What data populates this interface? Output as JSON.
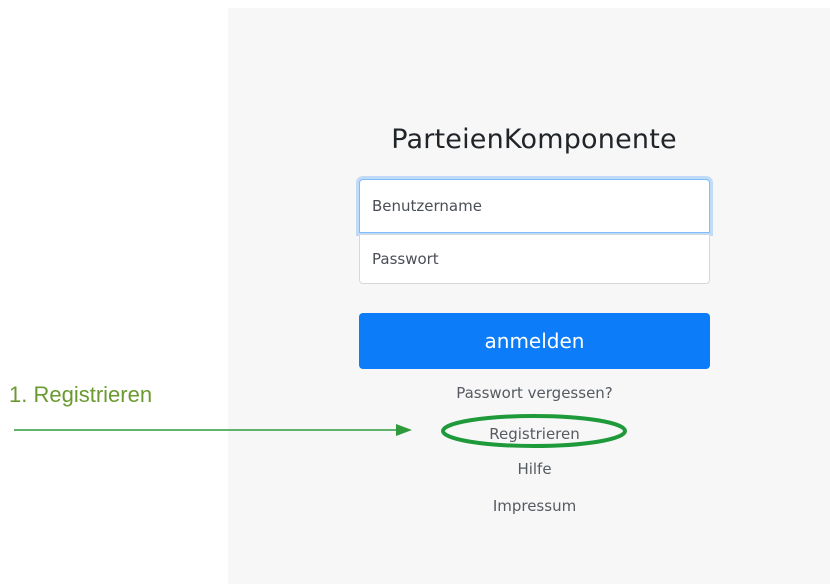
{
  "app": {
    "title": "ParteienKomponente"
  },
  "login_form": {
    "username_placeholder": "Benutzername",
    "password_placeholder": "Passwort",
    "submit_label": "anmelden"
  },
  "links": {
    "forgot_password": "Passwort vergessen?",
    "register": "Registrieren",
    "help": "Hilfe",
    "imprint": "Impressum"
  },
  "annotation": {
    "label": "1. Registrieren",
    "color": "#6a9a2f",
    "arrow_color": "#2e9a3c",
    "highlight_color": "#1f9a3a"
  },
  "colors": {
    "primary": "#0d7cf8",
    "panel_bg": "#f7f7f7",
    "focus_border": "#80bdff"
  }
}
